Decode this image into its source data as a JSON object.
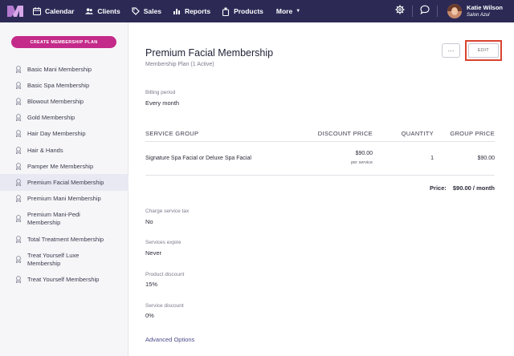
{
  "nav": {
    "items": [
      {
        "label": "Calendar",
        "icon": "calendar-icon"
      },
      {
        "label": "Clients",
        "icon": "clients-icon"
      },
      {
        "label": "Sales",
        "icon": "sales-icon"
      },
      {
        "label": "Reports",
        "icon": "reports-icon"
      },
      {
        "label": "Products",
        "icon": "products-icon"
      }
    ],
    "more_label": "More",
    "user_name": "Katie Wilson",
    "user_sub": "Salon Azul"
  },
  "sidebar": {
    "create_label": "CREATE MEMBERSHIP PLAN",
    "plans": [
      {
        "label": "Basic Mani Membership"
      },
      {
        "label": "Basic Spa Membership"
      },
      {
        "label": "Blowout Membership"
      },
      {
        "label": "Gold Membership"
      },
      {
        "label": "Hair Day Membership"
      },
      {
        "label": "Hair & Hands"
      },
      {
        "label": "Pamper Me Membership"
      },
      {
        "label": "Premium Facial Membership"
      },
      {
        "label": "Premium Mani Membership"
      },
      {
        "label": "Premium Mani-Pedi Membership"
      },
      {
        "label": "Total Treatment Membership"
      },
      {
        "label": "Treat Yourself Luxe Membership"
      },
      {
        "label": "Treat Yourself Membership"
      }
    ],
    "active_index": 7
  },
  "main": {
    "title": "Premium Facial Membership",
    "subtitle": "Membership Plan (1 Active)",
    "more_label": "···",
    "edit_label": "EDIT",
    "billing_label": "Billing period",
    "billing_value": "Every month",
    "table": {
      "headers": [
        "SERVICE GROUP",
        "DISCOUNT PRICE",
        "QUANTITY",
        "GROUP PRICE"
      ],
      "rows": [
        {
          "service": "Signature Spa Facial or Deluxe Spa Facial",
          "discount": "$90.00",
          "discount_sub": "per service",
          "quantity": "1",
          "group_price": "$90.00"
        }
      ]
    },
    "price_label": "Price:",
    "price_value": "$90.00 / month",
    "fields": [
      {
        "label": "Charge service tax",
        "value": "No"
      },
      {
        "label": "Services expire",
        "value": "Never"
      },
      {
        "label": "Product discount",
        "value": "15%"
      },
      {
        "label": "Service discount",
        "value": "0%"
      }
    ],
    "advanced_label": "Advanced Options"
  },
  "colors": {
    "nav_bg": "#2c2a55",
    "create_button": "#c42a8a",
    "edit_highlight": "#d9432f",
    "link": "#4c4a8a"
  }
}
